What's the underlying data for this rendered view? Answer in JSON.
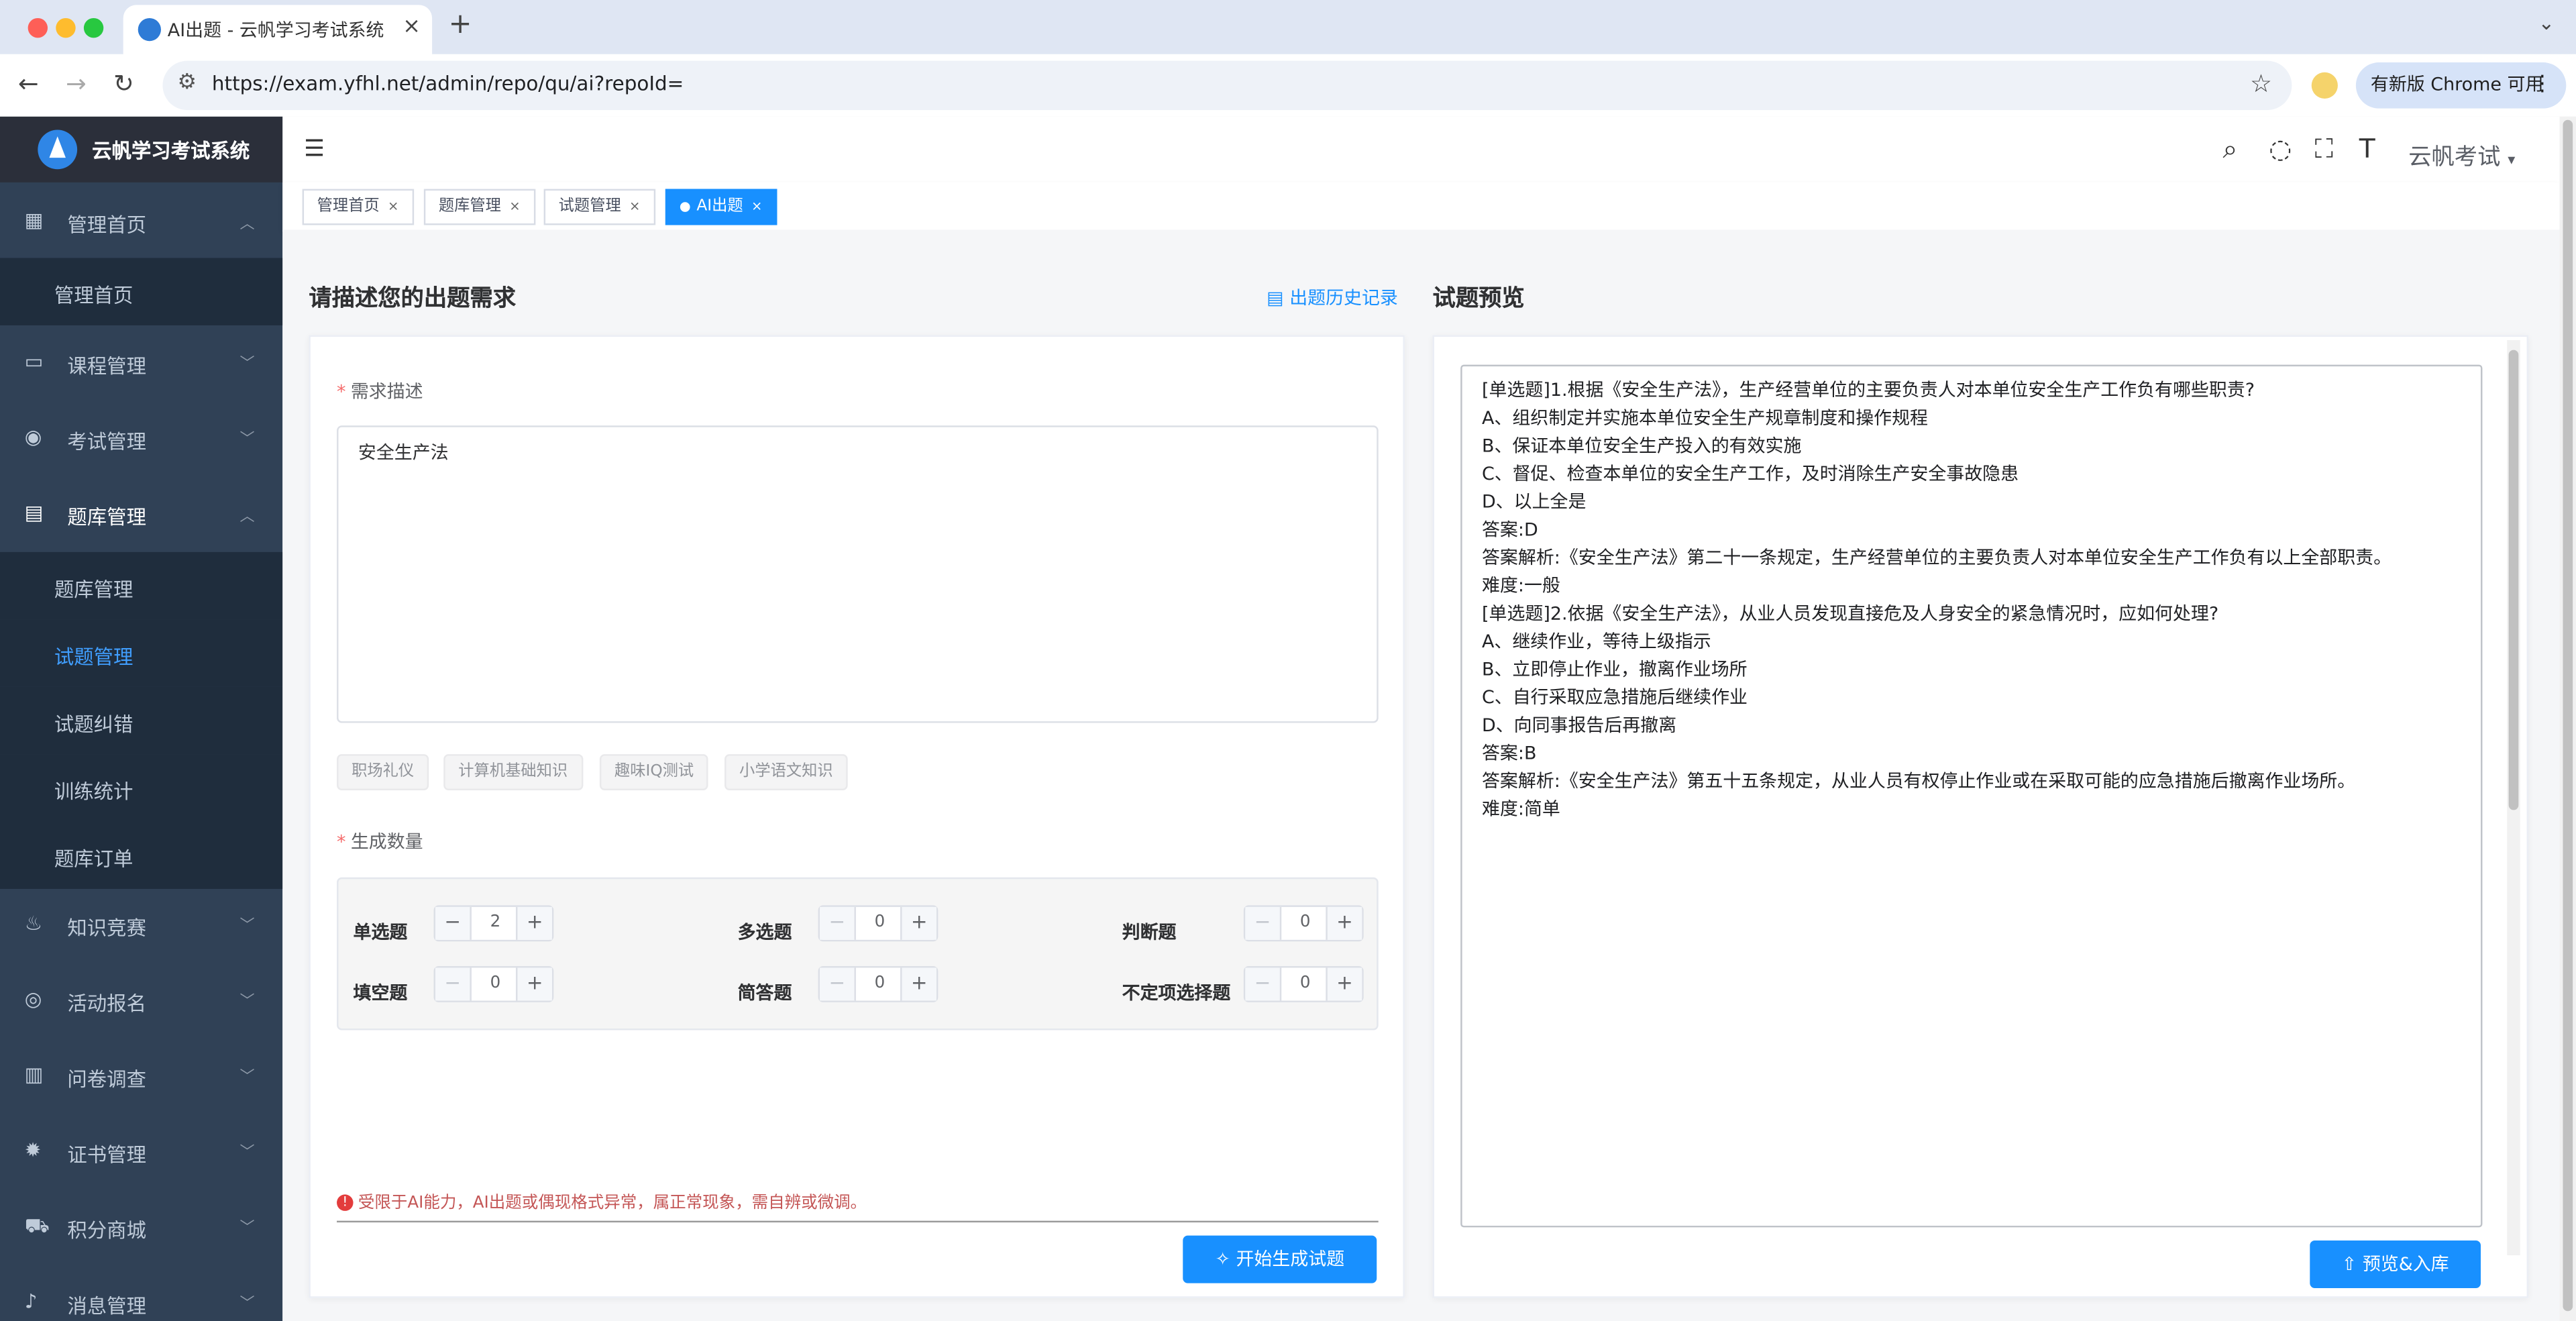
{
  "browser": {
    "tab_title": "AI出题 - 云帆学习考试系统",
    "url": "https://exam.yfhl.net/admin/repo/qu/ai?repoId=",
    "update_label": "有新版 Chrome 可用"
  },
  "brand": {
    "name": "云帆学习考试系统"
  },
  "sidebar": {
    "items": [
      {
        "label": "管理首页",
        "icon": "dashboard-icon"
      },
      {
        "label": "课程管理",
        "icon": "course-icon"
      },
      {
        "label": "考试管理",
        "icon": "exam-icon"
      },
      {
        "label": "题库管理",
        "icon": "question-bank-icon"
      },
      {
        "label": "知识竞赛",
        "icon": "flame-icon"
      },
      {
        "label": "活动报名",
        "icon": "activity-icon"
      },
      {
        "label": "问卷调查",
        "icon": "survey-icon"
      },
      {
        "label": "证书管理",
        "icon": "certificate-icon"
      },
      {
        "label": "积分商城",
        "icon": "cart-icon"
      },
      {
        "label": "消息管理",
        "icon": "bell-icon"
      }
    ],
    "home_sub": [
      "管理首页"
    ],
    "bank_sub": [
      "题库管理",
      "试题管理",
      "试题纠错",
      "训练统计",
      "题库订单"
    ]
  },
  "header": {
    "user_name": "云帆考试"
  },
  "tags": [
    "管理首页",
    "题库管理",
    "试题管理",
    "AI出题"
  ],
  "left": {
    "title": "请描述您的出题需求",
    "history_link": "出题历史记录",
    "desc_label": "需求描述",
    "desc_value": "安全生产法",
    "chips": [
      "职场礼仪",
      "计算机基础知识",
      "趣味IQ测试",
      "小学语文知识"
    ],
    "count_label": "生成数量",
    "types": [
      {
        "label": "单选题",
        "value": "2"
      },
      {
        "label": "多选题",
        "value": "0"
      },
      {
        "label": "判断题",
        "value": "0"
      },
      {
        "label": "填空题",
        "value": "0"
      },
      {
        "label": "简答题",
        "value": "0"
      },
      {
        "label": "不定项选择题",
        "value": "0"
      }
    ],
    "warning": "受限于AI能力，AI出题或偶现格式异常，属正常现象，需自辨或微调。",
    "generate_button": "开始生成试题"
  },
  "right": {
    "title": "试题预览",
    "preview_lines": [
      "[单选题]1.根据《安全生产法》，生产经营单位的主要负责人对本单位安全生产工作负有哪些职责?",
      "A、组织制定并实施本单位安全生产规章制度和操作规程",
      "B、保证本单位安全生产投入的有效实施",
      "C、督促、检查本单位的安全生产工作，及时消除生产安全事故隐患",
      "D、以上全是",
      "答案:D",
      "答案解析:《安全生产法》第二十一条规定，生产经营单位的主要负责人对本单位安全生产工作负有以上全部职责。",
      "难度:一般",
      "[单选题]2.依据《安全生产法》，从业人员发现直接危及人身安全的紧急情况时，应如何处理?",
      "A、继续作业，等待上级指示",
      "B、立即停止作业，撤离作业场所",
      "C、自行采取应急措施后继续作业",
      "D、向同事报告后再撤离",
      "答案:B",
      "答案解析:《安全生产法》第五十五条规定，从业人员有权停止作业或在采取可能的应急措施后撤离作业场所。",
      "难度:简单"
    ],
    "import_button": "预览&入库"
  }
}
